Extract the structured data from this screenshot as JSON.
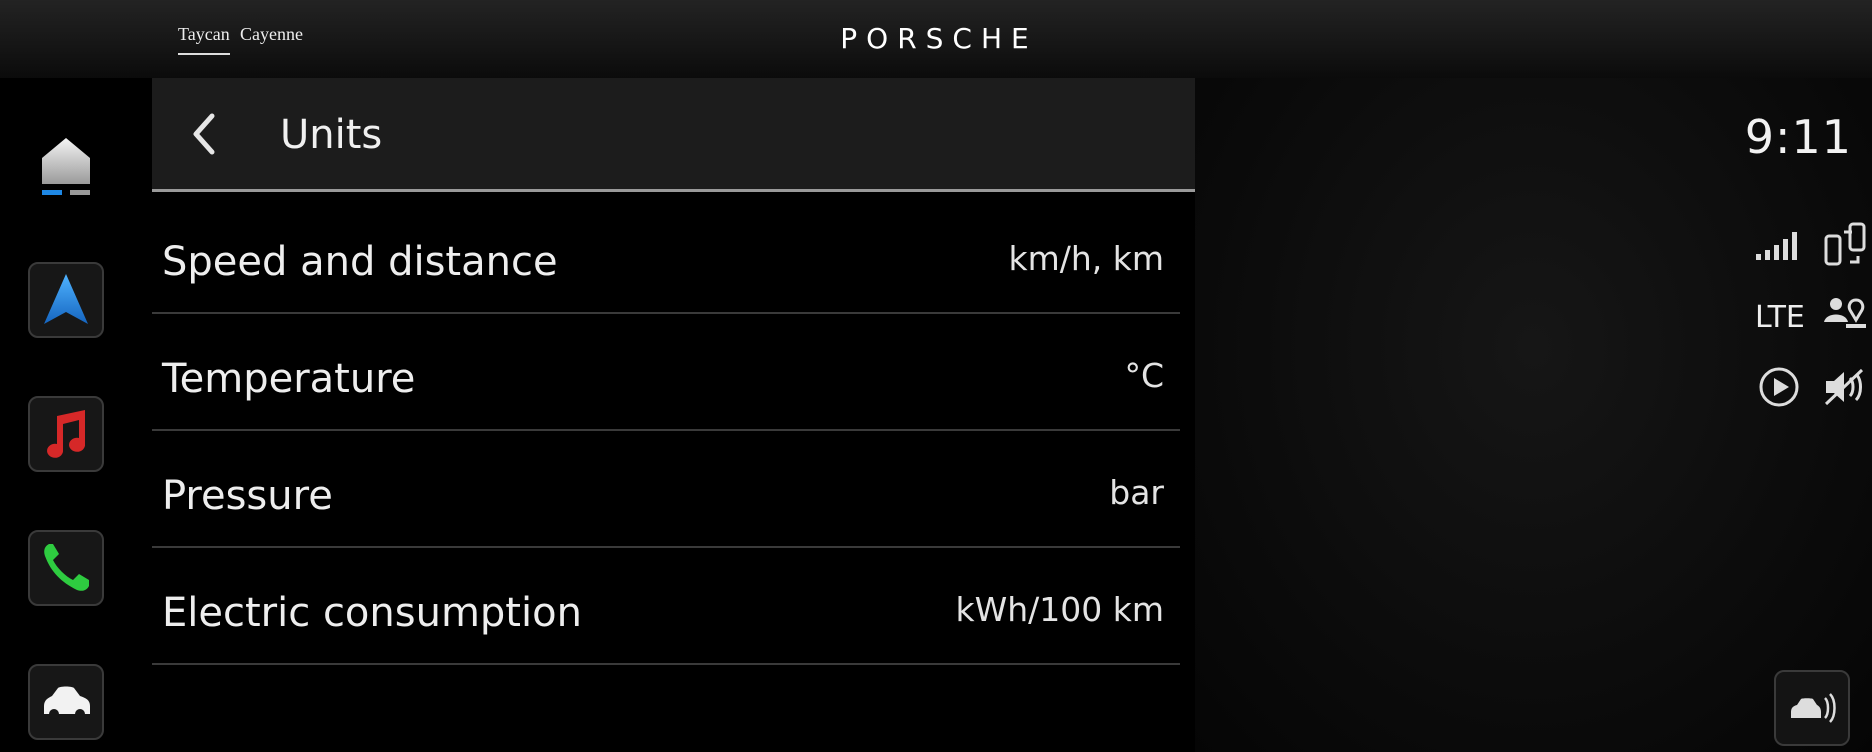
{
  "top_bar": {
    "tabs": [
      {
        "label": "Taycan",
        "active": true
      },
      {
        "label": "Cayenne",
        "active": false
      }
    ],
    "brand": "PORSCHE"
  },
  "dock": {
    "items": [
      "home-icon",
      "navigation-icon",
      "music-icon",
      "phone-icon",
      "car-icon"
    ]
  },
  "settings": {
    "title": "Units",
    "rows": [
      {
        "label": "Speed and distance",
        "value": "km/h, km"
      },
      {
        "label": "Temperature",
        "value": "°C"
      },
      {
        "label": "Pressure",
        "value": "bar"
      },
      {
        "label": "Electric consumption",
        "value": "kWh/100 km"
      }
    ]
  },
  "status": {
    "time": "9:11",
    "network": "LTE",
    "icons": [
      "signal-icon",
      "phone-connection-icon",
      "user-location-icon",
      "play-icon",
      "mute-icon",
      "car-assist-icon"
    ]
  },
  "colors": {
    "accent_blue": "#1e88e5",
    "music_red": "#d62828",
    "phone_green": "#2ecc40",
    "header_bg": "#1c1c1c"
  }
}
